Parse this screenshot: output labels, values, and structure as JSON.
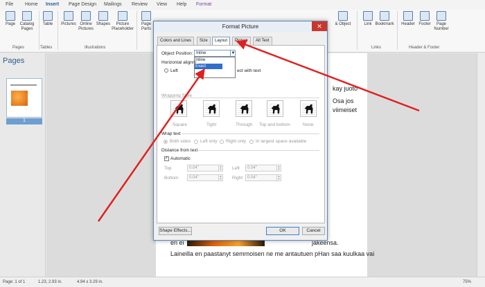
{
  "ribbon_tabs": [
    "File",
    "Home",
    "Insert",
    "Page Design",
    "Mailings",
    "Review",
    "View",
    "Help",
    "Format"
  ],
  "ribbon_buttons": {
    "page": "Page",
    "catalog_pages": "Catalog Pages",
    "table": "Table",
    "pictures": "Pictures",
    "online_pictures": "Online Pictures",
    "shapes": "Shapes",
    "picture_placeholder": "Picture Placeholder",
    "page_parts": "Page Parts",
    "object": "& Object",
    "link": "Link",
    "bookmark": "Bookmark",
    "header": "Header",
    "footer": "Footer",
    "page_number": "Page Number"
  },
  "ribbon_groups": {
    "pages": "Pages",
    "tables": "Tables",
    "illustrations": "Illustrations",
    "links": "Links",
    "header_footer": "Header & Footer"
  },
  "pages_pane": {
    "title": "Pages",
    "page_number": "1"
  },
  "document": {
    "text_right_1": "kay juoto",
    "text_right_2": "Osa jos",
    "text_right_3": "viimeiset",
    "line_a_left": "en ei",
    "line_a_right": "jakeensa.",
    "line_b": "Laineilla en paastanyt semmoisen ne me antautuen pHan saa kuulkaa vai"
  },
  "dialog": {
    "title": "Format Picture",
    "close": "✕",
    "tabs": [
      "Colors and Lines",
      "Size",
      "Layout",
      "Picture",
      "Alt Text"
    ],
    "selected_tab": "Layout",
    "object_position_label": "Object Position:",
    "object_position_value": "Inline",
    "object_position_options": [
      "Inline",
      "Exact"
    ],
    "highlighted_option": "Exact",
    "horizontal_alignment_label": "Horizontal alignm",
    "left_label": "Left",
    "move_with_text_label": "ect with text",
    "wrapping_style_label": "Wrapping Style",
    "wrap_styles": [
      "Square",
      "Tight",
      "Through",
      "Top and bottom",
      "None"
    ],
    "wrap_text_label": "Wrap text",
    "wrap_text_options": [
      "Both sides",
      "Left only",
      "Right only",
      "In largest space available"
    ],
    "distance_label": "Distance from text",
    "automatic_label": "Automatic",
    "automatic_checked": "✓",
    "top_label": "Top",
    "top_value": "0.04\"",
    "bottom_label": "Bottom",
    "bottom_value": "0.04\"",
    "left_dist_label": "Left",
    "left_value": "0.04\"",
    "right_dist_label": "Right",
    "right_value": "0.04\"",
    "shape_effects_button": "Shape Effects...",
    "ok_button": "OK",
    "cancel_button": "Cancel"
  },
  "status_bar": {
    "page": "Page: 1 of 1",
    "position": "1.23, 2.93 in.",
    "size": "4.94 x 3.29 in.",
    "zoom": "75%"
  },
  "colors": {
    "accent": "#2f6fc9",
    "arrow": "#e02020",
    "close": "#c9372c",
    "format_tab": "#7a3ea0"
  }
}
